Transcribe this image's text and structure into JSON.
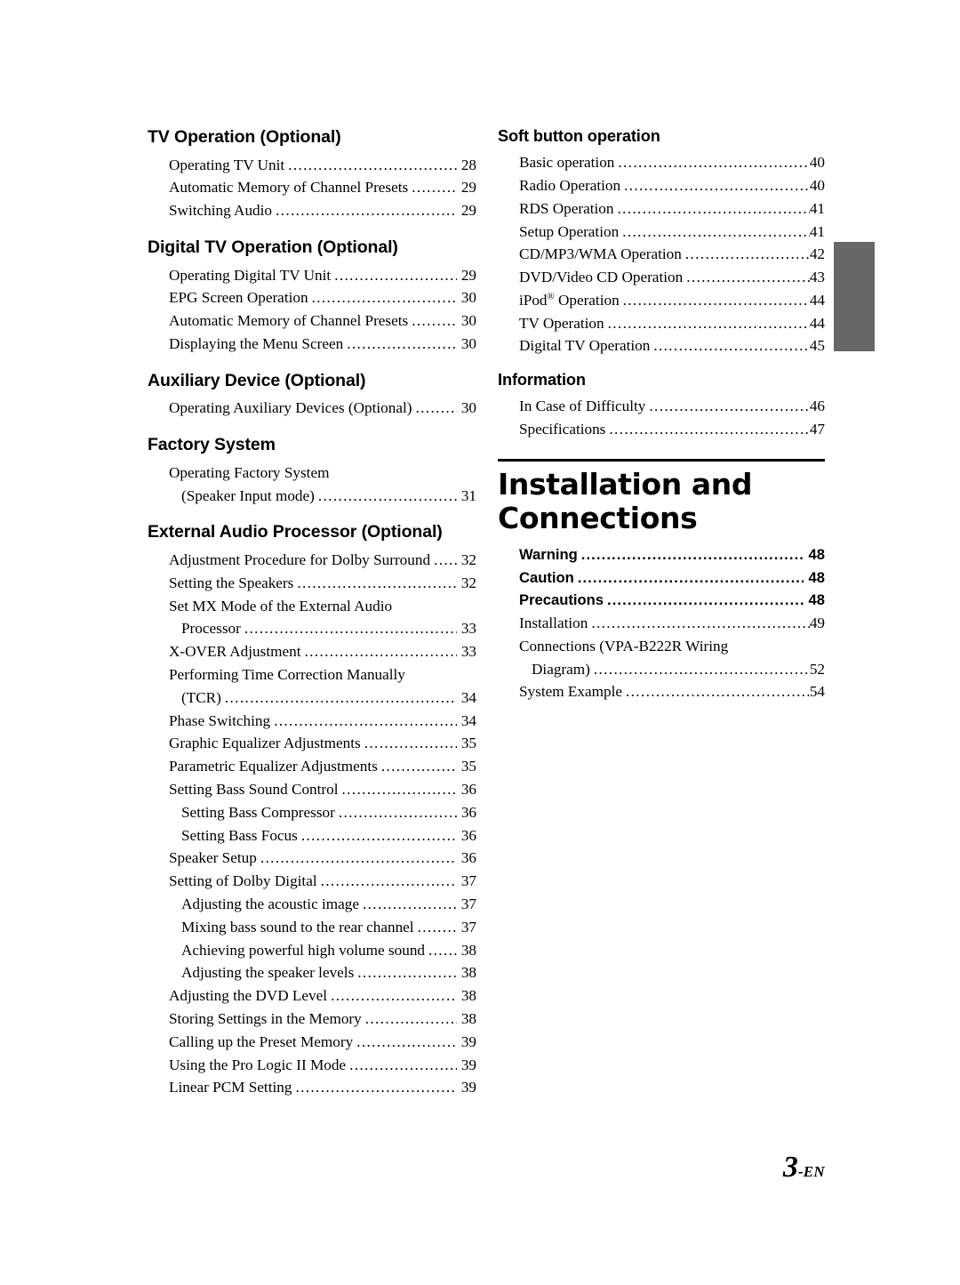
{
  "page": {
    "folio_number": "3",
    "folio_suffix": "-EN",
    "thumb_tab_color": "#676767",
    "rule_color": "#000000"
  },
  "left_column": {
    "sections": [
      {
        "heading": "TV Operation (Optional)",
        "entries": [
          {
            "title": "Operating TV Unit",
            "page": "28",
            "level": 1
          },
          {
            "title": "Automatic Memory of Channel Presets",
            "page": "29",
            "level": 1
          },
          {
            "title": "Switching Audio",
            "page": "29",
            "level": 1
          }
        ]
      },
      {
        "heading": "Digital TV Operation (Optional)",
        "entries": [
          {
            "title": "Operating Digital TV Unit",
            "page": "29",
            "level": 1
          },
          {
            "title": "EPG Screen Operation",
            "page": "30",
            "level": 1
          },
          {
            "title": "Automatic Memory of Channel Presets",
            "page": "30",
            "level": 1
          },
          {
            "title": "Displaying the Menu Screen",
            "page": "30",
            "level": 1
          }
        ]
      },
      {
        "heading": "Auxiliary Device (Optional)",
        "entries": [
          {
            "title": "Operating Auxiliary Devices (Optional)",
            "page": "30",
            "level": 1
          }
        ]
      },
      {
        "heading": "Factory System",
        "entries": [
          {
            "title": "Operating Factory System",
            "page": "",
            "level": 1,
            "wrap_first": true
          },
          {
            "title": "(Speaker Input mode)",
            "page": "31",
            "level": 1,
            "continuation": true
          }
        ]
      },
      {
        "heading": "External Audio Processor (Optional)",
        "entries": [
          {
            "title": "Adjustment Procedure for Dolby Surround",
            "page": "32",
            "level": 1
          },
          {
            "title": "Setting the Speakers",
            "page": "32",
            "level": 1
          },
          {
            "title": "Set MX Mode of the External Audio",
            "page": "",
            "level": 1,
            "wrap_first": true
          },
          {
            "title": "Processor",
            "page": "33",
            "level": 1,
            "continuation": true
          },
          {
            "title": "X-OVER Adjustment",
            "page": "33",
            "level": 1
          },
          {
            "title": "Performing Time Correction Manually",
            "page": "",
            "level": 1,
            "wrap_first": true
          },
          {
            "title": "(TCR)",
            "page": "34",
            "level": 1,
            "continuation": true
          },
          {
            "title": "Phase Switching",
            "page": "34",
            "level": 1
          },
          {
            "title": "Graphic Equalizer Adjustments",
            "page": "35",
            "level": 1
          },
          {
            "title": "Parametric Equalizer Adjustments",
            "page": "35",
            "level": 1
          },
          {
            "title": "Setting Bass Sound Control",
            "page": "36",
            "level": 1
          },
          {
            "title": "Setting Bass Compressor",
            "page": "36",
            "level": 2
          },
          {
            "title": "Setting Bass Focus",
            "page": "36",
            "level": 2
          },
          {
            "title": "Speaker Setup",
            "page": "36",
            "level": 1
          },
          {
            "title": "Setting of Dolby Digital",
            "page": "37",
            "level": 1
          },
          {
            "title": "Adjusting the acoustic image",
            "page": "37",
            "level": 2
          },
          {
            "title": "Mixing bass sound to the rear channel",
            "page": "37",
            "level": 2
          },
          {
            "title": "Achieving powerful high volume sound",
            "page": "38",
            "level": 2
          },
          {
            "title": "Adjusting the speaker levels",
            "page": "38",
            "level": 2
          },
          {
            "title": "Adjusting the DVD Level",
            "page": "38",
            "level": 1
          },
          {
            "title": "Storing Settings in the Memory",
            "page": "38",
            "level": 1
          },
          {
            "title": "Calling up the Preset Memory",
            "page": "39",
            "level": 1
          },
          {
            "title": "Using the Pro Logic II Mode",
            "page": "39",
            "level": 1
          },
          {
            "title": "Linear PCM Setting",
            "page": "39",
            "level": 1
          }
        ]
      }
    ]
  },
  "right_column": {
    "sections": [
      {
        "heading": "Soft button operation",
        "entries": [
          {
            "title": "Basic operation",
            "page": "40",
            "level": 1
          },
          {
            "title": "Radio Operation",
            "page": "40",
            "level": 1
          },
          {
            "title": "RDS Operation",
            "page": "41",
            "level": 1
          },
          {
            "title": "Setup Operation",
            "page": "41",
            "level": 1
          },
          {
            "title": "CD/MP3/WMA Operation",
            "page": "42",
            "level": 1
          },
          {
            "title": "DVD/Video CD Operation",
            "page": "43",
            "level": 1
          },
          {
            "title": "iPod® Operation",
            "page": "44",
            "level": 1,
            "has_registered": true
          },
          {
            "title": "TV Operation",
            "page": "44",
            "level": 1
          },
          {
            "title": "Digital TV Operation",
            "page": "45",
            "level": 1
          }
        ]
      },
      {
        "heading": "Information",
        "entries": [
          {
            "title": "In Case of Difficulty",
            "page": "46",
            "level": 1
          },
          {
            "title": "Specifications",
            "page": "47",
            "level": 1
          }
        ]
      }
    ],
    "chapter": {
      "title_line_1": "Installation and",
      "title_line_2": "Connections",
      "entries": [
        {
          "title": "Warning",
          "page": "48",
          "level": 1,
          "style": "bold-sans"
        },
        {
          "title": "Caution",
          "page": "48",
          "level": 1,
          "style": "bold-sans"
        },
        {
          "title": "Precautions",
          "page": "48",
          "level": 1,
          "style": "bold-sans"
        },
        {
          "title": "Installation",
          "page": "49",
          "level": 1
        },
        {
          "title": "Connections (VPA-B222R Wiring",
          "page": "",
          "level": 1,
          "wrap_first": true
        },
        {
          "title": "Diagram)",
          "page": "52",
          "level": 1,
          "continuation": true
        },
        {
          "title": "System Example",
          "page": "54",
          "level": 1
        }
      ]
    }
  }
}
